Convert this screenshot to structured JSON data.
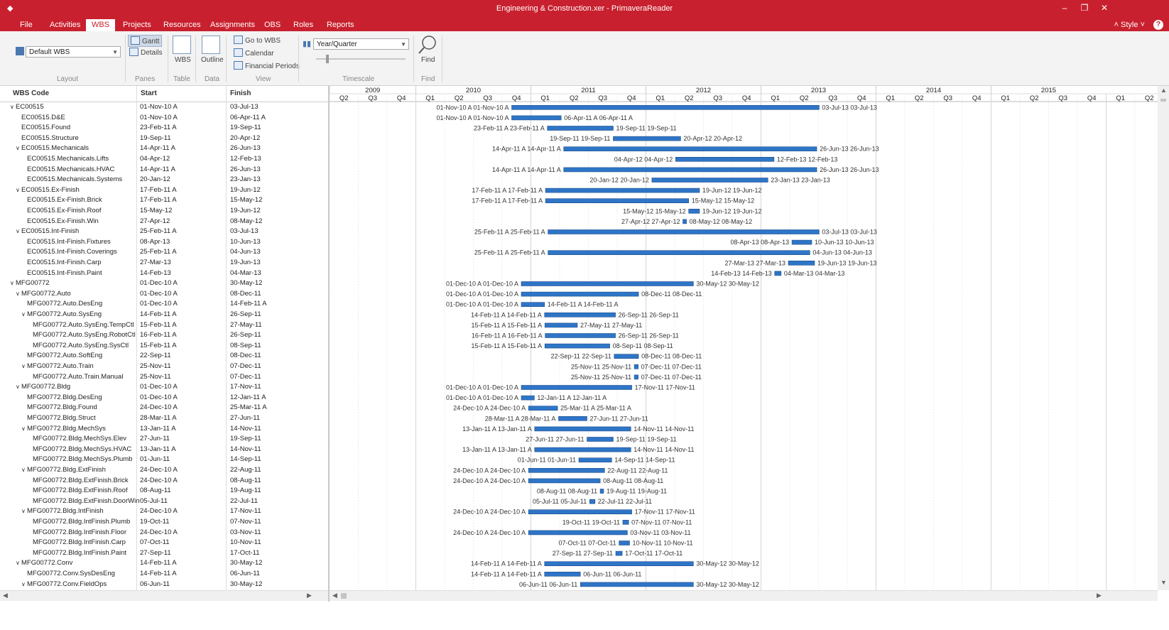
{
  "window": {
    "title": "Engineering & Construction.xer - PrimaveraReader"
  },
  "menu": {
    "items": [
      "File",
      "Activities",
      "WBS",
      "Projects",
      "Resources",
      "Assignments",
      "OBS",
      "Roles",
      "Reports"
    ],
    "active": "WBS",
    "style_label": "Style",
    "help_icon": "?"
  },
  "ribbon": {
    "layout_combo": "Default WBS",
    "layout_group": "Layout",
    "gantt_label": "Gantt",
    "details_label": "Details",
    "panes_group": "Panes",
    "wbs_label": "WBS",
    "table_group": "Table",
    "outline_label": "Outline",
    "data_group": "Data",
    "goto_wbs_label": "Go to WBS",
    "calendar_label": "Calendar",
    "financial_periods_label": "Financial Periods",
    "view_group": "View",
    "timescale_combo": "Year/Quarter",
    "timescale_group": "Timescale",
    "find_label": "Find",
    "find_group": "Find"
  },
  "columns": {
    "wbs_code": "WBS Code",
    "start": "Start",
    "finish": "Finish"
  },
  "timescale": {
    "years": [
      "2009",
      "2010",
      "2011",
      "2012",
      "2013",
      "2014",
      "2015"
    ],
    "start_quarter_label": "Q2",
    "quarters": [
      "Q1",
      "Q2",
      "Q3",
      "Q4"
    ]
  },
  "rows": [
    {
      "code": "EC00515",
      "indent": 0,
      "group": true,
      "start": "01-Nov-10 A",
      "finish": "03-Jul-13",
      "bs": "01-Nov-10",
      "be": "03-Jul-13",
      "ls": [
        "01-Nov-10 A",
        "01-Nov-10 A"
      ],
      "le": [
        "03-Jul-13",
        "03-Jul-13"
      ]
    },
    {
      "code": "EC00515.D&E",
      "indent": 1,
      "group": false,
      "start": "01-Nov-10 A",
      "finish": "06-Apr-11 A",
      "bs": "01-Nov-10",
      "be": "06-Apr-11",
      "ls": [
        "01-Nov-10 A",
        "01-Nov-10 A"
      ],
      "le": [
        "06-Apr-11 A",
        "06-Apr-11 A"
      ]
    },
    {
      "code": "EC00515.Found",
      "indent": 1,
      "group": false,
      "start": "23-Feb-11 A",
      "finish": "19-Sep-11",
      "bs": "23-Feb-11",
      "be": "19-Sep-11",
      "ls": [
        "23-Feb-11 A",
        "23-Feb-11 A"
      ],
      "le": [
        "19-Sep-11",
        "19-Sep-11"
      ]
    },
    {
      "code": "EC00515.Structure",
      "indent": 1,
      "group": false,
      "start": "19-Sep-11",
      "finish": "20-Apr-12",
      "bs": "19-Sep-11",
      "be": "20-Apr-12",
      "ls": [
        "19-Sep-11",
        "19-Sep-11"
      ],
      "le": [
        "20-Apr-12",
        "20-Apr-12"
      ]
    },
    {
      "code": "EC00515.Mechanicals",
      "indent": 1,
      "group": true,
      "start": "14-Apr-11 A",
      "finish": "26-Jun-13",
      "bs": "14-Apr-11",
      "be": "26-Jun-13",
      "ls": [
        "14-Apr-11 A",
        "14-Apr-11 A"
      ],
      "le": [
        "26-Jun-13",
        "26-Jun-13"
      ]
    },
    {
      "code": "EC00515.Mechanicals.Lifts",
      "indent": 2,
      "group": false,
      "start": "04-Apr-12",
      "finish": "12-Feb-13",
      "bs": "04-Apr-12",
      "be": "12-Feb-13",
      "ls": [
        "04-Apr-12",
        "04-Apr-12"
      ],
      "le": [
        "12-Feb-13",
        "12-Feb-13"
      ]
    },
    {
      "code": "EC00515.Mechanicals.HVAC",
      "indent": 2,
      "group": false,
      "start": "14-Apr-11 A",
      "finish": "26-Jun-13",
      "bs": "14-Apr-11",
      "be": "26-Jun-13",
      "ls": [
        "14-Apr-11 A",
        "14-Apr-11 A"
      ],
      "le": [
        "26-Jun-13",
        "26-Jun-13"
      ]
    },
    {
      "code": "EC00515.Mechanicals.Systems",
      "indent": 2,
      "group": false,
      "start": "20-Jan-12",
      "finish": "23-Jan-13",
      "bs": "20-Jan-12",
      "be": "23-Jan-13",
      "ls": [
        "20-Jan-12",
        "20-Jan-12"
      ],
      "le": [
        "23-Jan-13",
        "23-Jan-13"
      ]
    },
    {
      "code": "EC00515.Ex-Finish",
      "indent": 1,
      "group": true,
      "start": "17-Feb-11 A",
      "finish": "19-Jun-12",
      "bs": "17-Feb-11",
      "be": "19-Jun-12",
      "ls": [
        "17-Feb-11 A",
        "17-Feb-11 A"
      ],
      "le": [
        "19-Jun-12",
        "19-Jun-12"
      ]
    },
    {
      "code": "EC00515.Ex-Finish.Brick",
      "indent": 2,
      "group": false,
      "start": "17-Feb-11 A",
      "finish": "15-May-12",
      "bs": "17-Feb-11",
      "be": "15-May-12",
      "ls": [
        "17-Feb-11 A",
        "17-Feb-11 A"
      ],
      "le": [
        "15-May-12",
        "15-May-12"
      ]
    },
    {
      "code": "EC00515.Ex-Finish.Roof",
      "indent": 2,
      "group": false,
      "start": "15-May-12",
      "finish": "19-Jun-12",
      "bs": "15-May-12",
      "be": "19-Jun-12",
      "ls": [
        "15-May-12",
        "15-May-12"
      ],
      "le": [
        "19-Jun-12",
        "19-Jun-12"
      ]
    },
    {
      "code": "EC00515.Ex-Finish.Win",
      "indent": 2,
      "group": false,
      "start": "27-Apr-12",
      "finish": "08-May-12",
      "bs": "27-Apr-12",
      "be": "08-May-12",
      "ls": [
        "27-Apr-12",
        "27-Apr-12"
      ],
      "le": [
        "08-May-12",
        "08-May-12"
      ]
    },
    {
      "code": "EC00515.Int-Finish",
      "indent": 1,
      "group": true,
      "start": "25-Feb-11 A",
      "finish": "03-Jul-13",
      "bs": "25-Feb-11",
      "be": "03-Jul-13",
      "ls": [
        "25-Feb-11 A",
        "25-Feb-11 A"
      ],
      "le": [
        "03-Jul-13",
        "03-Jul-13"
      ]
    },
    {
      "code": "EC00515.Int-Finish.Fixtures",
      "indent": 2,
      "group": false,
      "start": "08-Apr-13",
      "finish": "10-Jun-13",
      "bs": "08-Apr-13",
      "be": "10-Jun-13",
      "ls": [
        "08-Apr-13",
        "08-Apr-13"
      ],
      "le": [
        "10-Jun-13",
        "10-Jun-13"
      ]
    },
    {
      "code": "EC00515.Int-Finish.Coverings",
      "indent": 2,
      "group": false,
      "start": "25-Feb-11 A",
      "finish": "04-Jun-13",
      "bs": "25-Feb-11",
      "be": "04-Jun-13",
      "ls": [
        "25-Feb-11 A",
        "25-Feb-11 A"
      ],
      "le": [
        "04-Jun-13",
        "04-Jun-13"
      ]
    },
    {
      "code": "EC00515.Int-Finish.Carp",
      "indent": 2,
      "group": false,
      "start": "27-Mar-13",
      "finish": "19-Jun-13",
      "bs": "27-Mar-13",
      "be": "19-Jun-13",
      "ls": [
        "27-Mar-13",
        "27-Mar-13"
      ],
      "le": [
        "19-Jun-13",
        "19-Jun-13"
      ]
    },
    {
      "code": "EC00515.Int-Finish.Paint",
      "indent": 2,
      "group": false,
      "start": "14-Feb-13",
      "finish": "04-Mar-13",
      "bs": "14-Feb-13",
      "be": "04-Mar-13",
      "ls": [
        "14-Feb-13",
        "14-Feb-13"
      ],
      "le": [
        "04-Mar-13",
        "04-Mar-13"
      ]
    },
    {
      "code": "MFG00772",
      "indent": 0,
      "group": true,
      "start": "01-Dec-10 A",
      "finish": "30-May-12",
      "bs": "01-Dec-10",
      "be": "30-May-12",
      "ls": [
        "01-Dec-10 A",
        "01-Dec-10 A"
      ],
      "le": [
        "30-May-12",
        "30-May-12"
      ]
    },
    {
      "code": "MFG00772.Auto",
      "indent": 1,
      "group": true,
      "start": "01-Dec-10 A",
      "finish": "08-Dec-11",
      "bs": "01-Dec-10",
      "be": "08-Dec-11",
      "ls": [
        "01-Dec-10 A",
        "01-Dec-10 A"
      ],
      "le": [
        "08-Dec-11",
        "08-Dec-11"
      ]
    },
    {
      "code": "MFG00772.Auto.DesEng",
      "indent": 2,
      "group": false,
      "start": "01-Dec-10 A",
      "finish": "14-Feb-11 A",
      "bs": "01-Dec-10",
      "be": "14-Feb-11",
      "ls": [
        "01-Dec-10 A",
        "01-Dec-10 A"
      ],
      "le": [
        "14-Feb-11 A",
        "14-Feb-11 A"
      ]
    },
    {
      "code": "MFG00772.Auto.SysEng",
      "indent": 2,
      "group": true,
      "start": "14-Feb-11 A",
      "finish": "26-Sep-11",
      "bs": "14-Feb-11",
      "be": "26-Sep-11",
      "ls": [
        "14-Feb-11 A",
        "14-Feb-11 A"
      ],
      "le": [
        "26-Sep-11",
        "26-Sep-11"
      ]
    },
    {
      "code": "MFG00772.Auto.SysEng.TempCtl",
      "indent": 3,
      "group": false,
      "start": "15-Feb-11 A",
      "finish": "27-May-11",
      "bs": "15-Feb-11",
      "be": "27-May-11",
      "ls": [
        "15-Feb-11 A",
        "15-Feb-11 A"
      ],
      "le": [
        "27-May-11",
        "27-May-11"
      ]
    },
    {
      "code": "MFG00772.Auto.SysEng.RobotCtl",
      "indent": 3,
      "group": false,
      "start": "16-Feb-11 A",
      "finish": "26-Sep-11",
      "bs": "16-Feb-11",
      "be": "26-Sep-11",
      "ls": [
        "16-Feb-11 A",
        "16-Feb-11 A"
      ],
      "le": [
        "26-Sep-11",
        "26-Sep-11"
      ]
    },
    {
      "code": "MFG00772.Auto.SysEng.SysCtl",
      "indent": 3,
      "group": false,
      "start": "15-Feb-11 A",
      "finish": "08-Sep-11",
      "bs": "15-Feb-11",
      "be": "08-Sep-11",
      "ls": [
        "15-Feb-11 A",
        "15-Feb-11 A"
      ],
      "le": [
        "08-Sep-11",
        "08-Sep-11"
      ]
    },
    {
      "code": "MFG00772.Auto.SoftEng",
      "indent": 2,
      "group": false,
      "start": "22-Sep-11",
      "finish": "08-Dec-11",
      "bs": "22-Sep-11",
      "be": "08-Dec-11",
      "ls": [
        "22-Sep-11",
        "22-Sep-11"
      ],
      "le": [
        "08-Dec-11",
        "08-Dec-11"
      ]
    },
    {
      "code": "MFG00772.Auto.Train",
      "indent": 2,
      "group": true,
      "start": "25-Nov-11",
      "finish": "07-Dec-11",
      "bs": "25-Nov-11",
      "be": "07-Dec-11",
      "ls": [
        "25-Nov-11",
        "25-Nov-11"
      ],
      "le": [
        "07-Dec-11",
        "07-Dec-11"
      ]
    },
    {
      "code": "MFG00772.Auto.Train.Manual",
      "indent": 3,
      "group": false,
      "start": "25-Nov-11",
      "finish": "07-Dec-11",
      "bs": "25-Nov-11",
      "be": "07-Dec-11",
      "ls": [
        "25-Nov-11",
        "25-Nov-11"
      ],
      "le": [
        "07-Dec-11",
        "07-Dec-11"
      ]
    },
    {
      "code": "MFG00772.Bldg",
      "indent": 1,
      "group": true,
      "start": "01-Dec-10 A",
      "finish": "17-Nov-11",
      "bs": "01-Dec-10",
      "be": "17-Nov-11",
      "ls": [
        "01-Dec-10 A",
        "01-Dec-10 A"
      ],
      "le": [
        "17-Nov-11",
        "17-Nov-11"
      ]
    },
    {
      "code": "MFG00772.Bldg.DesEng",
      "indent": 2,
      "group": false,
      "start": "01-Dec-10 A",
      "finish": "12-Jan-11 A",
      "bs": "01-Dec-10",
      "be": "12-Jan-11",
      "ls": [
        "01-Dec-10 A",
        "01-Dec-10 A"
      ],
      "le": [
        "12-Jan-11 A",
        "12-Jan-11 A"
      ]
    },
    {
      "code": "MFG00772.Bldg.Found",
      "indent": 2,
      "group": false,
      "start": "24-Dec-10 A",
      "finish": "25-Mar-11 A",
      "bs": "24-Dec-10",
      "be": "25-Mar-11",
      "ls": [
        "24-Dec-10 A",
        "24-Dec-10 A"
      ],
      "le": [
        "25-Mar-11 A",
        "25-Mar-11 A"
      ]
    },
    {
      "code": "MFG00772.Bldg.Struct",
      "indent": 2,
      "group": false,
      "start": "28-Mar-11 A",
      "finish": "27-Jun-11",
      "bs": "28-Mar-11",
      "be": "27-Jun-11",
      "ls": [
        "28-Mar-11 A",
        "28-Mar-11 A"
      ],
      "le": [
        "27-Jun-11",
        "27-Jun-11"
      ]
    },
    {
      "code": "MFG00772.Bldg.MechSys",
      "indent": 2,
      "group": true,
      "start": "13-Jan-11 A",
      "finish": "14-Nov-11",
      "bs": "13-Jan-11",
      "be": "14-Nov-11",
      "ls": [
        "13-Jan-11 A",
        "13-Jan-11 A"
      ],
      "le": [
        "14-Nov-11",
        "14-Nov-11"
      ]
    },
    {
      "code": "MFG00772.Bldg.MechSys.Elev",
      "indent": 3,
      "group": false,
      "start": "27-Jun-11",
      "finish": "19-Sep-11",
      "bs": "27-Jun-11",
      "be": "19-Sep-11",
      "ls": [
        "27-Jun-11",
        "27-Jun-11"
      ],
      "le": [
        "19-Sep-11",
        "19-Sep-11"
      ]
    },
    {
      "code": "MFG00772.Bldg.MechSys.HVAC",
      "indent": 3,
      "group": false,
      "start": "13-Jan-11 A",
      "finish": "14-Nov-11",
      "bs": "13-Jan-11",
      "be": "14-Nov-11",
      "ls": [
        "13-Jan-11 A",
        "13-Jan-11 A"
      ],
      "le": [
        "14-Nov-11",
        "14-Nov-11"
      ]
    },
    {
      "code": "MFG00772.Bldg.MechSys.Plumb",
      "indent": 3,
      "group": false,
      "start": "01-Jun-11",
      "finish": "14-Sep-11",
      "bs": "01-Jun-11",
      "be": "14-Sep-11",
      "ls": [
        "01-Jun-11",
        "01-Jun-11"
      ],
      "le": [
        "14-Sep-11",
        "14-Sep-11"
      ]
    },
    {
      "code": "MFG00772.Bldg.ExtFinish",
      "indent": 2,
      "group": true,
      "start": "24-Dec-10 A",
      "finish": "22-Aug-11",
      "bs": "24-Dec-10",
      "be": "22-Aug-11",
      "ls": [
        "24-Dec-10 A",
        "24-Dec-10 A"
      ],
      "le": [
        "22-Aug-11",
        "22-Aug-11"
      ]
    },
    {
      "code": "MFG00772.Bldg.ExtFinish.Brick",
      "indent": 3,
      "group": false,
      "start": "24-Dec-10 A",
      "finish": "08-Aug-11",
      "bs": "24-Dec-10",
      "be": "08-Aug-11",
      "ls": [
        "24-Dec-10 A",
        "24-Dec-10 A"
      ],
      "le": [
        "08-Aug-11",
        "08-Aug-11"
      ]
    },
    {
      "code": "MFG00772.Bldg.ExtFinish.Roof",
      "indent": 3,
      "group": false,
      "start": "08-Aug-11",
      "finish": "19-Aug-11",
      "bs": "08-Aug-11",
      "be": "19-Aug-11",
      "ls": [
        "08-Aug-11",
        "08-Aug-11"
      ],
      "le": [
        "19-Aug-11",
        "19-Aug-11"
      ]
    },
    {
      "code": "MFG00772.Bldg.ExtFinish.DoorWin",
      "indent": 3,
      "group": false,
      "start": "05-Jul-11",
      "finish": "22-Jul-11",
      "bs": "05-Jul-11",
      "be": "22-Jul-11",
      "ls": [
        "05-Jul-11",
        "05-Jul-11"
      ],
      "le": [
        "22-Jul-11",
        "22-Jul-11"
      ]
    },
    {
      "code": "MFG00772.Bldg.IntFinish",
      "indent": 2,
      "group": true,
      "start": "24-Dec-10 A",
      "finish": "17-Nov-11",
      "bs": "24-Dec-10",
      "be": "17-Nov-11",
      "ls": [
        "24-Dec-10 A",
        "24-Dec-10 A"
      ],
      "le": [
        "17-Nov-11",
        "17-Nov-11"
      ]
    },
    {
      "code": "MFG00772.Bldg.IntFinish.Plumb",
      "indent": 3,
      "group": false,
      "start": "19-Oct-11",
      "finish": "07-Nov-11",
      "bs": "19-Oct-11",
      "be": "07-Nov-11",
      "ls": [
        "19-Oct-11",
        "19-Oct-11"
      ],
      "le": [
        "07-Nov-11",
        "07-Nov-11"
      ]
    },
    {
      "code": "MFG00772.Bldg.IntFinish.Floor",
      "indent": 3,
      "group": false,
      "start": "24-Dec-10 A",
      "finish": "03-Nov-11",
      "bs": "24-Dec-10",
      "be": "03-Nov-11",
      "ls": [
        "24-Dec-10 A",
        "24-Dec-10 A"
      ],
      "le": [
        "03-Nov-11",
        "03-Nov-11"
      ]
    },
    {
      "code": "MFG00772.Bldg.IntFinish.Carp",
      "indent": 3,
      "group": false,
      "start": "07-Oct-11",
      "finish": "10-Nov-11",
      "bs": "07-Oct-11",
      "be": "10-Nov-11",
      "ls": [
        "07-Oct-11",
        "07-Oct-11"
      ],
      "le": [
        "10-Nov-11",
        "10-Nov-11"
      ]
    },
    {
      "code": "MFG00772.Bldg.IntFinish.Paint",
      "indent": 3,
      "group": false,
      "start": "27-Sep-11",
      "finish": "17-Oct-11",
      "bs": "27-Sep-11",
      "be": "17-Oct-11",
      "ls": [
        "27-Sep-11",
        "27-Sep-11"
      ],
      "le": [
        "17-Oct-11",
        "17-Oct-11"
      ]
    },
    {
      "code": "MFG00772.Conv",
      "indent": 1,
      "group": true,
      "start": "14-Feb-11 A",
      "finish": "30-May-12",
      "bs": "14-Feb-11",
      "be": "30-May-12",
      "ls": [
        "14-Feb-11 A",
        "14-Feb-11 A"
      ],
      "le": [
        "30-May-12",
        "30-May-12"
      ]
    },
    {
      "code": "MFG00772.Conv.SysDesEng",
      "indent": 2,
      "group": false,
      "start": "14-Feb-11 A",
      "finish": "06-Jun-11",
      "bs": "14-Feb-11",
      "be": "06-Jun-11",
      "ls": [
        "14-Feb-11 A",
        "14-Feb-11 A"
      ],
      "le": [
        "06-Jun-11",
        "06-Jun-11"
      ]
    },
    {
      "code": "MFG00772.Conv.FieldOps",
      "indent": 2,
      "group": true,
      "start": "06-Jun-11",
      "finish": "30-May-12",
      "bs": "06-Jun-11",
      "be": "30-May-12",
      "ls": [
        "06-Jun-11",
        "06-Jun-11"
      ],
      "le": [
        "30-May-12",
        "30-May-12"
      ]
    }
  ],
  "colors": {
    "titlebar": "#c8202e",
    "bar": "#2e75c7"
  }
}
